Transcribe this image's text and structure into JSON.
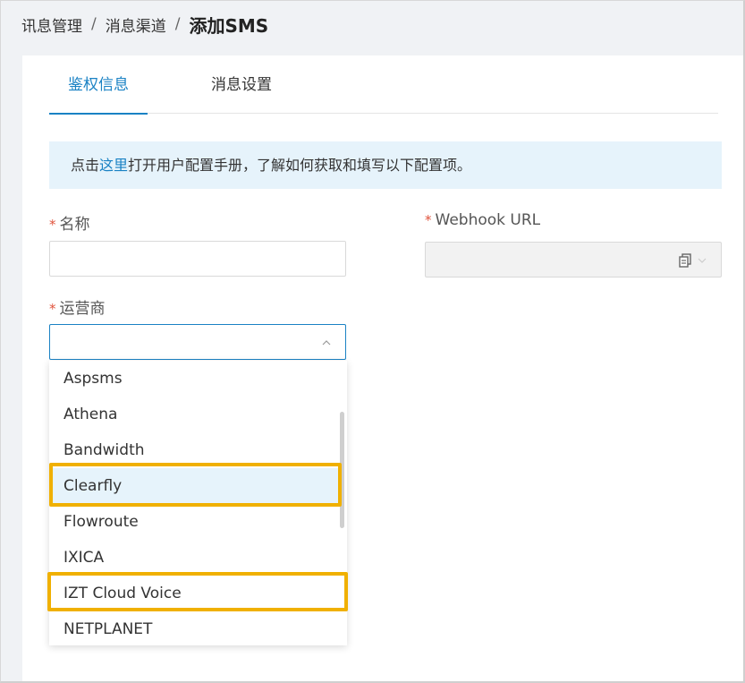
{
  "breadcrumb": {
    "items": [
      "讯息管理",
      "消息渠道"
    ],
    "separator": "/",
    "current": "添加SMS"
  },
  "tabs": [
    {
      "label": "鉴权信息",
      "active": true
    },
    {
      "label": "消息设置",
      "active": false
    }
  ],
  "tip": {
    "prefix": "点击",
    "link": "这里",
    "suffix": "打开用户配置手册，了解如何获取和填写以下配置项。"
  },
  "form": {
    "required_mark": "*",
    "name_label": "名称",
    "name_value": "",
    "webhook_label": "Webhook URL",
    "webhook_value": "",
    "carrier_label": "运营商",
    "carrier_value": ""
  },
  "carrier_options": [
    "Aspsms",
    "Athena",
    "Bandwidth",
    "Clearfly",
    "Flowroute",
    "IXICA",
    "IZT Cloud Voice",
    "NETPLANET"
  ],
  "hovered_option": "Clearfly",
  "highlighted_options": [
    "Clearfly",
    "IZT Cloud Voice"
  ],
  "colors": {
    "accent": "#1a82c4",
    "highlight": "#f0b000",
    "required": "#e0533c",
    "tip_bg": "#e6f3fb"
  },
  "icons": {
    "copy": "copy-icon",
    "webhook_chevron": "chevron-down-icon",
    "carrier_chevron": "chevron-up-icon"
  }
}
